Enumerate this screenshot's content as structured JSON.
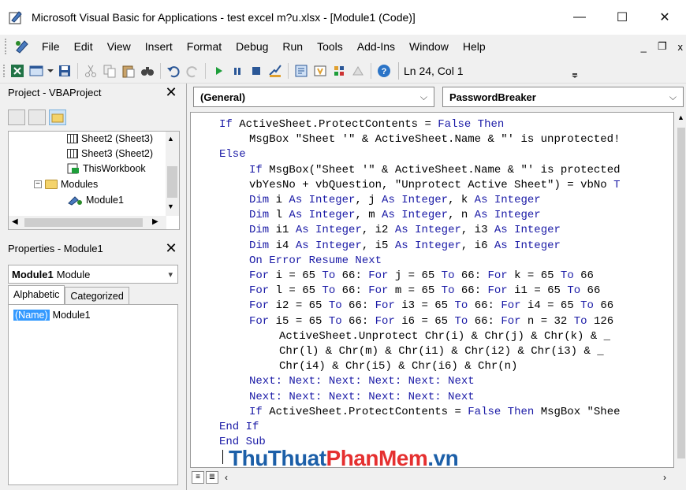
{
  "window": {
    "title": "Microsoft Visual Basic for Applications - test excel m?u.xlsx - [Module1 (Code)]",
    "minimize": "—",
    "maximize": "☐",
    "close": "✕"
  },
  "menu": {
    "items": [
      "File",
      "Edit",
      "View",
      "Insert",
      "Format",
      "Debug",
      "Run",
      "Tools",
      "Add-Ins",
      "Window",
      "Help"
    ],
    "right_min": "_",
    "right_restore": "❐",
    "right_close": "x"
  },
  "toolbar": {
    "status": "Ln 24, Col 1"
  },
  "project": {
    "title": "Project - VBAProject",
    "close": "✕",
    "tree": [
      {
        "label": "Sheet2 (Sheet3)",
        "icon": "sheet-icon"
      },
      {
        "label": "Sheet3 (Sheet2)",
        "icon": "sheet-icon"
      },
      {
        "label": "ThisWorkbook",
        "icon": "workbook-icon"
      },
      {
        "label": "Modules",
        "icon": "folder-icon"
      },
      {
        "label": "Module1",
        "icon": "module-icon"
      }
    ]
  },
  "properties": {
    "title": "Properties - Module1",
    "close": "✕",
    "object_name": "Module1",
    "object_type": "Module",
    "tabs": [
      "Alphabetic",
      "Categorized"
    ],
    "row_key": "(Name)",
    "row_value": "Module1"
  },
  "code": {
    "object_combo": "(General)",
    "proc_combo": "PasswordBreaker",
    "lines": [
      {
        "indent": 0,
        "parts": [
          [
            "kw",
            "If "
          ],
          [
            "tx",
            "ActiveSheet.ProtectContents = "
          ],
          [
            "kw",
            "False Then"
          ]
        ]
      },
      {
        "indent": 1,
        "parts": [
          [
            "tx",
            "MsgBox \"Sheet '\" & ActiveSheet.Name & \"' is unprotected!"
          ]
        ]
      },
      {
        "indent": 0,
        "parts": [
          [
            "kw",
            "Else"
          ]
        ]
      },
      {
        "indent": 1,
        "parts": [
          [
            "kw",
            "If "
          ],
          [
            "tx",
            "MsgBox(\"Sheet '\" & ActiveSheet.Name & \"' is protected"
          ]
        ]
      },
      {
        "indent": 1,
        "parts": [
          [
            "tx",
            "vbYesNo + vbQuestion, \"Unprotect Active Sheet\") = vbNo "
          ],
          [
            "kw",
            "T"
          ]
        ]
      },
      {
        "indent": 1,
        "parts": [
          [
            "kw",
            "Dim "
          ],
          [
            "tx",
            "i "
          ],
          [
            "kw",
            "As Integer"
          ],
          [
            "tx",
            ", j "
          ],
          [
            "kw",
            "As Integer"
          ],
          [
            "tx",
            ", k "
          ],
          [
            "kw",
            "As Integer"
          ]
        ]
      },
      {
        "indent": 1,
        "parts": [
          [
            "kw",
            "Dim "
          ],
          [
            "tx",
            "l "
          ],
          [
            "kw",
            "As Integer"
          ],
          [
            "tx",
            ", m "
          ],
          [
            "kw",
            "As Integer"
          ],
          [
            "tx",
            ", n "
          ],
          [
            "kw",
            "As Integer"
          ]
        ]
      },
      {
        "indent": 1,
        "parts": [
          [
            "kw",
            "Dim "
          ],
          [
            "tx",
            "i1 "
          ],
          [
            "kw",
            "As Integer"
          ],
          [
            "tx",
            ", i2 "
          ],
          [
            "kw",
            "As Integer"
          ],
          [
            "tx",
            ", i3 "
          ],
          [
            "kw",
            "As Integer"
          ]
        ]
      },
      {
        "indent": 1,
        "parts": [
          [
            "kw",
            "Dim "
          ],
          [
            "tx",
            "i4 "
          ],
          [
            "kw",
            "As Integer"
          ],
          [
            "tx",
            ", i5 "
          ],
          [
            "kw",
            "As Integer"
          ],
          [
            "tx",
            ", i6 "
          ],
          [
            "kw",
            "As Integer"
          ]
        ]
      },
      {
        "indent": 1,
        "parts": [
          [
            "kw",
            "On Error Resume Next"
          ]
        ]
      },
      {
        "indent": 1,
        "parts": [
          [
            "kw",
            "For "
          ],
          [
            "tx",
            "i = 65 "
          ],
          [
            "kw",
            "To "
          ],
          [
            "tx",
            "66: "
          ],
          [
            "kw",
            "For "
          ],
          [
            "tx",
            "j = 65 "
          ],
          [
            "kw",
            "To "
          ],
          [
            "tx",
            "66: "
          ],
          [
            "kw",
            "For "
          ],
          [
            "tx",
            "k = 65 "
          ],
          [
            "kw",
            "To "
          ],
          [
            "tx",
            "66"
          ]
        ]
      },
      {
        "indent": 1,
        "parts": [
          [
            "kw",
            "For "
          ],
          [
            "tx",
            "l = 65 "
          ],
          [
            "kw",
            "To "
          ],
          [
            "tx",
            "66: "
          ],
          [
            "kw",
            "For "
          ],
          [
            "tx",
            "m = 65 "
          ],
          [
            "kw",
            "To "
          ],
          [
            "tx",
            "66: "
          ],
          [
            "kw",
            "For "
          ],
          [
            "tx",
            "i1 = 65 "
          ],
          [
            "kw",
            "To "
          ],
          [
            "tx",
            "66"
          ]
        ]
      },
      {
        "indent": 1,
        "parts": [
          [
            "kw",
            "For "
          ],
          [
            "tx",
            "i2 = 65 "
          ],
          [
            "kw",
            "To "
          ],
          [
            "tx",
            "66: "
          ],
          [
            "kw",
            "For "
          ],
          [
            "tx",
            "i3 = 65 "
          ],
          [
            "kw",
            "To "
          ],
          [
            "tx",
            "66: "
          ],
          [
            "kw",
            "For "
          ],
          [
            "tx",
            "i4 = 65 "
          ],
          [
            "kw",
            "To "
          ],
          [
            "tx",
            "66"
          ]
        ]
      },
      {
        "indent": 1,
        "parts": [
          [
            "kw",
            "For "
          ],
          [
            "tx",
            "i5 = 65 "
          ],
          [
            "kw",
            "To "
          ],
          [
            "tx",
            "66: "
          ],
          [
            "kw",
            "For "
          ],
          [
            "tx",
            "i6 = 65 "
          ],
          [
            "kw",
            "To "
          ],
          [
            "tx",
            "66: "
          ],
          [
            "kw",
            "For "
          ],
          [
            "tx",
            "n = 32 "
          ],
          [
            "kw",
            "To "
          ],
          [
            "tx",
            "126"
          ]
        ]
      },
      {
        "indent": 2,
        "parts": [
          [
            "tx",
            "ActiveSheet.Unprotect Chr(i) & Chr(j) & Chr(k) & _"
          ]
        ]
      },
      {
        "indent": 2,
        "parts": [
          [
            "tx",
            "Chr(l) & Chr(m) & Chr(i1) & Chr(i2) & Chr(i3) & _"
          ]
        ]
      },
      {
        "indent": 2,
        "parts": [
          [
            "tx",
            "Chr(i4) & Chr(i5) & Chr(i6) & Chr(n)"
          ]
        ]
      },
      {
        "indent": 1,
        "parts": [
          [
            "kw",
            "Next: Next: Next: Next: Next: Next"
          ]
        ]
      },
      {
        "indent": 1,
        "parts": [
          [
            "kw",
            "Next: Next: Next: Next: Next: Next"
          ]
        ]
      },
      {
        "indent": 1,
        "parts": [
          [
            "kw",
            "If "
          ],
          [
            "tx",
            "ActiveSheet.ProtectContents = "
          ],
          [
            "kw",
            "False Then "
          ],
          [
            "tx",
            "MsgBox \"Shee"
          ]
        ]
      },
      {
        "indent": 0,
        "parts": [
          [
            "kw",
            "End If"
          ]
        ]
      },
      {
        "indent": 0,
        "parts": [
          [
            "kw",
            "End Sub"
          ]
        ]
      }
    ]
  },
  "watermark": {
    "part1": "ThuThuat",
    "part2": "PhanMem",
    "part3": ".vn"
  },
  "colors": {
    "keyword": "#1a1aa6",
    "selection": "#3399ff"
  }
}
